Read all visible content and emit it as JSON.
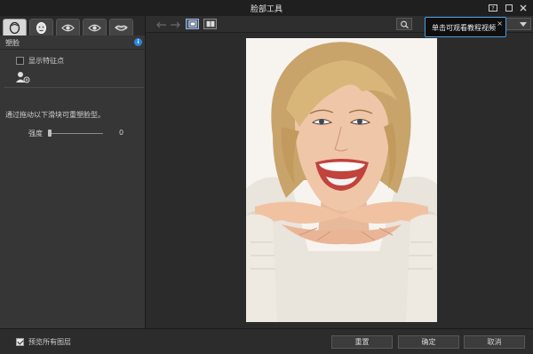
{
  "window": {
    "title": "脸部工具"
  },
  "tooltip": {
    "text": "单击可观看教程视频",
    "close": "×"
  },
  "panel": {
    "section_title": "塑脸",
    "show_features_label": "显示特征点",
    "hint": "通过拖动以下滑块可重塑脸型。",
    "slider": {
      "label": "强度",
      "value": "0"
    }
  },
  "footer": {
    "preview_all_layers": "预览所有图层",
    "reset_label": "重置",
    "ok_label": "确定",
    "cancel_label": "取消"
  },
  "icons": {
    "title_bar": [
      "help-video-icon",
      "maximize-icon",
      "close-icon"
    ],
    "tabs": [
      "face-shape-icon",
      "face-icon",
      "eye-icon",
      "eye-icon",
      "lips-icon"
    ],
    "toolbar": [
      "undo-icon",
      "redo-icon",
      "single-view-icon",
      "compare-view-icon",
      "search-icon",
      "chevron-down-icon"
    ]
  },
  "colors": {
    "accent": "#2e86de",
    "tooltip_border": "#4a9ee0",
    "background": "#2b2b2b"
  }
}
